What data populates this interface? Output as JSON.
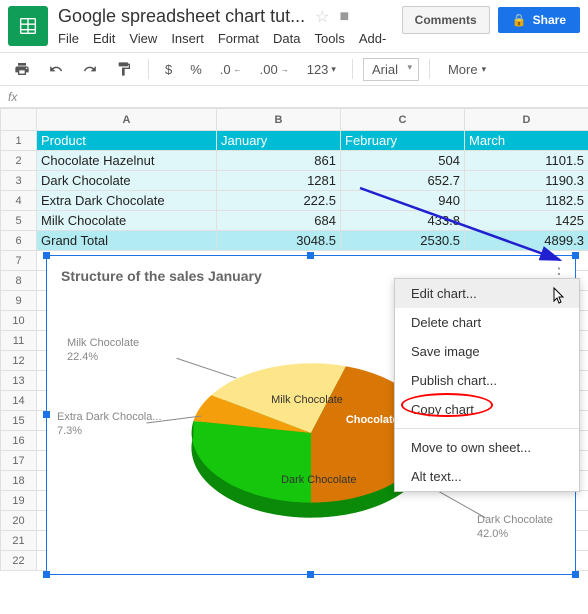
{
  "doc_title": "Google spreadsheet chart tut...",
  "menus": {
    "file": "File",
    "edit": "Edit",
    "view": "View",
    "insert": "Insert",
    "format": "Format",
    "data": "Data",
    "tools": "Tools",
    "addons": "Add-"
  },
  "buttons": {
    "comments": "Comments",
    "share": "Share"
  },
  "toolbar": {
    "currency": "$",
    "percent": "%",
    "dec_dec": ".0",
    "dec_inc": ".00",
    "num_fmt": "123",
    "font": "Arial",
    "more": "More"
  },
  "fx": "fx",
  "columns": [
    "A",
    "B",
    "C",
    "D"
  ],
  "rows": [
    "1",
    "2",
    "3",
    "4",
    "5",
    "6",
    "7",
    "8",
    "9",
    "10",
    "11",
    "12",
    "13",
    "14",
    "15",
    "16",
    "17",
    "18",
    "19",
    "20",
    "21",
    "22"
  ],
  "table": {
    "header": [
      "Product",
      "January",
      "February",
      "March"
    ],
    "data": [
      [
        "Chocolate Hazelnut",
        "861",
        "504",
        "1101.5"
      ],
      [
        "Dark Chocolate",
        "1281",
        "652.7",
        "1190.3"
      ],
      [
        "Extra Dark Chocolate",
        "222.5",
        "940",
        "1182.5"
      ],
      [
        "Milk Chocolate",
        "684",
        "433.8",
        "1425"
      ]
    ],
    "total": [
      "Grand Total",
      "3048.5",
      "2530.5",
      "4899.3"
    ]
  },
  "chart": {
    "title": "Structure of the sales January",
    "labels": {
      "milk": "Milk Chocolate",
      "milk_pct": "22.4%",
      "extra": "Extra Dark Chocola...",
      "extra_pct": "7.3%",
      "hazel": "Chocolate Haze",
      "dark": "Dark Chocolate",
      "dark_pct": "42.0%",
      "dark2": "Dark Chocolate",
      "milk2": "Milk Chocolate"
    }
  },
  "context_menu": {
    "edit": "Edit chart...",
    "delete": "Delete chart",
    "save": "Save image",
    "publish": "Publish chart...",
    "copy": "Copy chart",
    "move": "Move to own sheet...",
    "alt": "Alt text..."
  },
  "chart_data": {
    "type": "pie",
    "title": "Structure of the sales January",
    "categories": [
      "Chocolate Hazelnut",
      "Dark Chocolate",
      "Extra Dark Chocolate",
      "Milk Chocolate"
    ],
    "values": [
      861,
      1281,
      222.5,
      684
    ],
    "percentages": [
      28.2,
      42.0,
      7.3,
      22.4
    ],
    "colors": [
      "#d97706",
      "#16c60c",
      "#f59e0b",
      "#fde68a"
    ]
  }
}
